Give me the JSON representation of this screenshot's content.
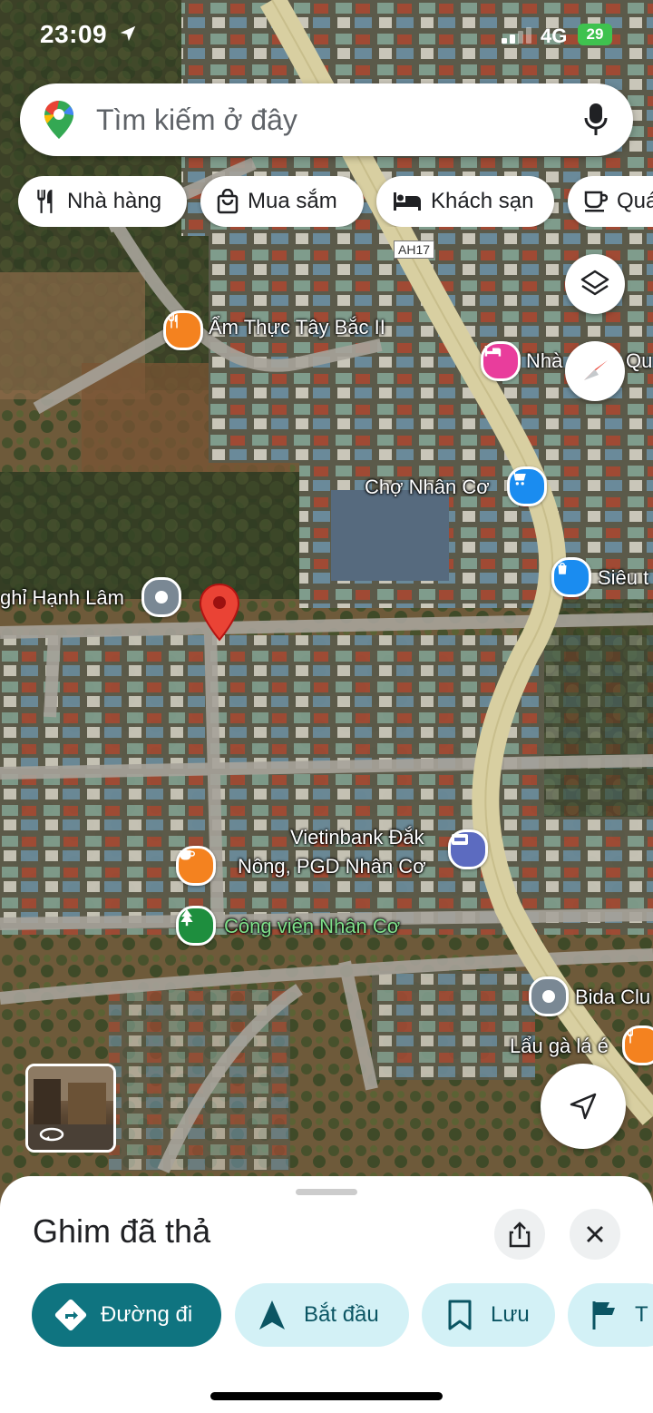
{
  "status": {
    "time": "23:09",
    "network": "4G",
    "battery": "29"
  },
  "search": {
    "placeholder": "Tìm kiếm ở đây",
    "icons": [
      "google-maps-pin-icon",
      "mic-icon"
    ]
  },
  "chips": [
    {
      "label": "Nhà hàng",
      "icon": "restaurant-icon"
    },
    {
      "label": "Mua sắm",
      "icon": "shopping-bag-icon"
    },
    {
      "label": "Khách sạn",
      "icon": "hotel-bed-icon"
    },
    {
      "label": "Quá",
      "icon": "coffee-icon"
    }
  ],
  "map": {
    "road_sign": "AH17",
    "places": {
      "am_thuc": "Ẩm Thực Tây Bắc II",
      "nha_nghi": "Nhà",
      "nha_nghi_tail": "Qu",
      "cho": "Chợ Nhân Cơ",
      "sieu_thi": "Siêu t",
      "hanh_lam": "ghỉ Hạnh Lâm",
      "vietinbank_1": "Vietinbank Đắk",
      "vietinbank_2": "Nông, PGD Nhân Cơ",
      "cong_vien": "Công viên Nhân Cơ",
      "bida": "Bida Clu",
      "lau_ga": "Lẩu gà lá é"
    },
    "colors": {
      "restaurant": "#f4821f",
      "hotel": "#e93d9c",
      "shopping": "#1a8cf0",
      "generic": "#7a8894",
      "bank": "#5c6bc0",
      "park": "#1e8e3e",
      "pin": "#ea4335"
    }
  },
  "sheet": {
    "title": "Ghim đã thả",
    "actions": [
      {
        "label": "Đường đi",
        "icon": "directions-icon"
      },
      {
        "label": "Bắt đầu",
        "icon": "navigation-arrow-icon"
      },
      {
        "label": "Lưu",
        "icon": "bookmark-icon"
      },
      {
        "label": "T",
        "icon": "flag-icon"
      }
    ]
  }
}
